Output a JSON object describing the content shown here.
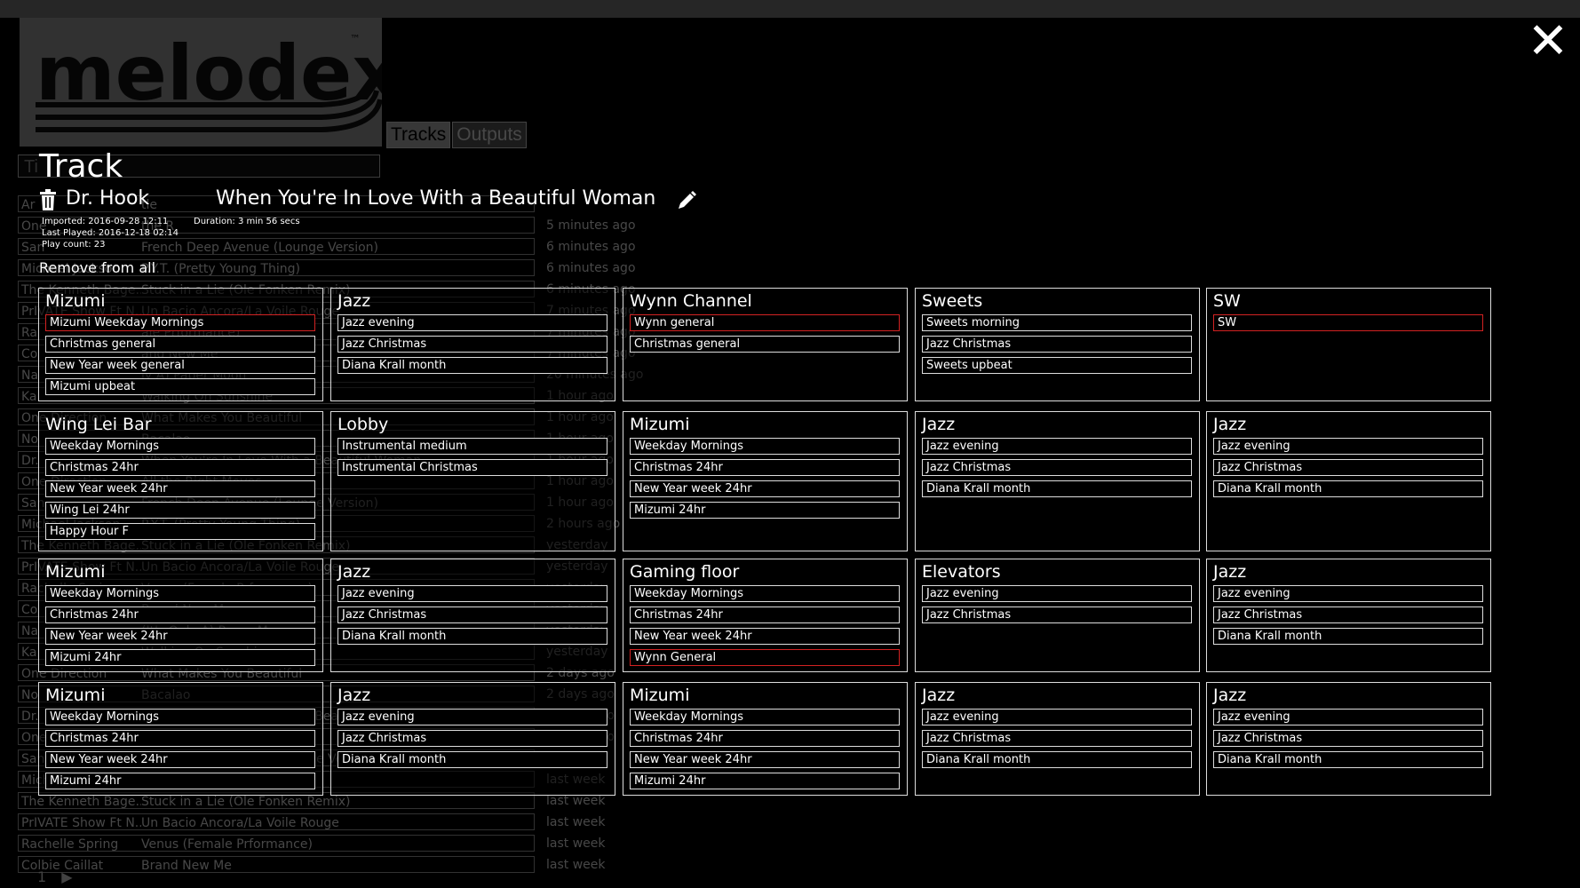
{
  "app": {
    "logo_text": "melodex",
    "trademark": "™"
  },
  "tabs": [
    "Tracks",
    "Outputs"
  ],
  "search": {
    "value": "Ti"
  },
  "close_label": "✕",
  "background_rows": [
    {
      "artist": "Ar",
      "title": "tle",
      "when": ""
    },
    {
      "artist": "One",
      "title": "the R",
      "when": "5 minutes ago"
    },
    {
      "artist": "San",
      "title": "French Deep Avenue (Lounge Version)",
      "when": "6 minutes ago"
    },
    {
      "artist": "Michael Jackson",
      "title": "P.Y.T. (Pretty Young Thing)",
      "when": "6 minutes ago"
    },
    {
      "artist": "The Kenneth Bage...",
      "title": "Stuck in a Lie (Ole Fonken Remix)",
      "when": "6 minutes ago"
    },
    {
      "artist": "PrIVATE Show Ft N...",
      "title": "Un Bacio Ancora/La Voile Rouge",
      "when": "7 minutes ago"
    },
    {
      "artist": "Ra",
      "title": "ale Prformance)",
      "when": "7 minutes ago"
    },
    {
      "artist": "Co",
      "title": "and New Me",
      "when": "7 minutes ago"
    },
    {
      "artist": "Na",
      "title": "ly A) Paper Moon",
      "when": "20 minutes ago"
    },
    {
      "artist": "Ka",
      "title": "Walking On Sunshine",
      "when": "1 hour ago"
    },
    {
      "artist": "One Direction",
      "title": "What Makes You Beautiful",
      "when": "1 hour ago"
    },
    {
      "artist": "No",
      "title": "Bacalao",
      "when": "1 hour ago"
    },
    {
      "artist": "Dr.",
      "title": "When You're In Love With a Beautiful Woman",
      "when": "1 hour ago"
    },
    {
      "artist": "One Direction",
      "title": "All the Right Moves",
      "when": "1 hour ago"
    },
    {
      "artist": "San",
      "title": "French Deep Avenue (Lounge Version)",
      "when": "1 hour ago"
    },
    {
      "artist": "Michael Jackson",
      "title": "P.Y.T. (Pretty Young Thing)",
      "when": "2 hours ago"
    },
    {
      "artist": "The Kenneth Bage...",
      "title": "Stuck in a Lie (Ole Fonken Remix)",
      "when": "yesterday"
    },
    {
      "artist": "PrIVATE Show Ft N...",
      "title": "Un Bacio Ancora/La Voile Rouge",
      "when": "yesterday"
    },
    {
      "artist": "Rachelle Spring",
      "title": "Venus (Female Prformance)",
      "when": "yesterday"
    },
    {
      "artist": "Co",
      "title": "Brand New Me",
      "when": "yesterday"
    },
    {
      "artist": "Na",
      "title": "(It's Only A) Paper Moon",
      "when": "yesterday"
    },
    {
      "artist": "Ka",
      "title": "Walking On Sunshine",
      "when": "yesterday"
    },
    {
      "artist": "One Direction",
      "title": "What Makes You Beautiful",
      "when": "2 days ago"
    },
    {
      "artist": "No",
      "title": "Bacalao",
      "when": "2 days ago"
    },
    {
      "artist": "Dr.",
      "title": "When You're In Love With a Beautiful Woman",
      "when": "2 days ago"
    },
    {
      "artist": "One Direction",
      "title": "All the Right Moves",
      "when": "2 days ago"
    },
    {
      "artist": "San",
      "title": "French Deep Avenue (Lounge Version)",
      "when": "last week"
    },
    {
      "artist": "Michael Jackson",
      "title": "P.Y.T. (Pretty Young Thing)",
      "when": "last week"
    },
    {
      "artist": "The Kenneth Bage...",
      "title": "Stuck in a Lie (Ole Fonken Remix)",
      "when": "last week"
    },
    {
      "artist": "PrIVATE Show Ft N...",
      "title": "Un Bacio Ancora/La Voile Rouge",
      "when": "last week"
    },
    {
      "artist": "Rachelle Spring",
      "title": "Venus (Female Prformance)",
      "when": "last week"
    },
    {
      "artist": "Colbie Caillat",
      "title": "Brand New Me",
      "when": "last week"
    }
  ],
  "pager": {
    "page": "1",
    "next": "▶"
  },
  "track": {
    "heading": "Track",
    "artist": "Dr. Hook",
    "title": "When You're In Love With a Beautiful Woman",
    "imported": "Imported: 2016-09-28 12:11",
    "duration": "Duration: 3 min 56 secs",
    "last_played": "Last Played: 2016-12-18 02:14",
    "play_count": "Play count: 23",
    "remove_all": "Remove from all"
  },
  "colors": {
    "selected_border": "#d32222",
    "card_border": "#dddddd"
  },
  "channels": [
    {
      "name": "Mizumi",
      "playlists": [
        {
          "label": "Mizumi Weekday Mornings",
          "selected": true
        },
        {
          "label": "Christmas general",
          "selected": false
        },
        {
          "label": "New Year week general",
          "selected": false
        },
        {
          "label": "Mizumi upbeat",
          "selected": false
        }
      ]
    },
    {
      "name": "Jazz",
      "playlists": [
        {
          "label": "Jazz evening",
          "selected": false
        },
        {
          "label": "Jazz Christmas",
          "selected": false
        },
        {
          "label": "Diana Krall month",
          "selected": false
        }
      ]
    },
    {
      "name": "Wynn Channel",
      "playlists": [
        {
          "label": "Wynn general",
          "selected": true
        },
        {
          "label": "Christmas general",
          "selected": false
        }
      ]
    },
    {
      "name": "Sweets",
      "playlists": [
        {
          "label": "Sweets morning",
          "selected": false
        },
        {
          "label": "Jazz Christmas",
          "selected": false
        },
        {
          "label": "Sweets upbeat",
          "selected": false
        }
      ]
    },
    {
      "name": "SW",
      "playlists": [
        {
          "label": "SW",
          "selected": true
        }
      ]
    },
    {
      "name": "Wing Lei Bar",
      "playlists": [
        {
          "label": "Weekday Mornings",
          "selected": false
        },
        {
          "label": "Christmas 24hr",
          "selected": false
        },
        {
          "label": "New Year week 24hr",
          "selected": false
        },
        {
          "label": "Wing Lei 24hr",
          "selected": false
        },
        {
          "label": "Happy Hour F",
          "selected": false
        }
      ]
    },
    {
      "name": "Lobby",
      "playlists": [
        {
          "label": "Instrumental medium",
          "selected": false
        },
        {
          "label": "Instrumental Christmas",
          "selected": false
        }
      ]
    },
    {
      "name": "Mizumi",
      "playlists": [
        {
          "label": "Weekday Mornings",
          "selected": false
        },
        {
          "label": "Christmas 24hr",
          "selected": false
        },
        {
          "label": "New Year week 24hr",
          "selected": false
        },
        {
          "label": "Mizumi 24hr",
          "selected": false
        }
      ]
    },
    {
      "name": "Jazz",
      "playlists": [
        {
          "label": "Jazz evening",
          "selected": false
        },
        {
          "label": "Jazz Christmas",
          "selected": false
        },
        {
          "label": "Diana Krall month",
          "selected": false
        }
      ]
    },
    {
      "name": "Jazz",
      "playlists": [
        {
          "label": "Jazz evening",
          "selected": false
        },
        {
          "label": "Jazz Christmas",
          "selected": false
        },
        {
          "label": "Diana Krall month",
          "selected": false
        }
      ]
    },
    {
      "name": "Mizumi",
      "playlists": [
        {
          "label": "Weekday Mornings",
          "selected": false
        },
        {
          "label": "Christmas 24hr",
          "selected": false
        },
        {
          "label": "New Year week 24hr",
          "selected": false
        },
        {
          "label": "Mizumi 24hr",
          "selected": false
        }
      ]
    },
    {
      "name": "Jazz",
      "playlists": [
        {
          "label": "Jazz evening",
          "selected": false
        },
        {
          "label": "Jazz Christmas",
          "selected": false
        },
        {
          "label": "Diana Krall month",
          "selected": false
        }
      ]
    },
    {
      "name": "Gaming floor",
      "playlists": [
        {
          "label": "Weekday Mornings",
          "selected": false
        },
        {
          "label": "Christmas 24hr",
          "selected": false
        },
        {
          "label": "New Year week 24hr",
          "selected": false
        },
        {
          "label": "Wynn General",
          "selected": true
        }
      ]
    },
    {
      "name": "Elevators",
      "playlists": [
        {
          "label": "Jazz evening",
          "selected": false
        },
        {
          "label": "Jazz Christmas",
          "selected": false
        }
      ]
    },
    {
      "name": "Jazz",
      "playlists": [
        {
          "label": "Jazz evening",
          "selected": false
        },
        {
          "label": "Jazz Christmas",
          "selected": false
        },
        {
          "label": "Diana Krall month",
          "selected": false
        }
      ]
    },
    {
      "name": "Mizumi",
      "playlists": [
        {
          "label": "Weekday Mornings",
          "selected": false
        },
        {
          "label": "Christmas 24hr",
          "selected": false
        },
        {
          "label": "New Year week 24hr",
          "selected": false
        },
        {
          "label": "Mizumi 24hr",
          "selected": false
        }
      ]
    },
    {
      "name": "Jazz",
      "playlists": [
        {
          "label": "Jazz evening",
          "selected": false
        },
        {
          "label": "Jazz Christmas",
          "selected": false
        },
        {
          "label": "Diana Krall month",
          "selected": false
        }
      ]
    },
    {
      "name": "Mizumi",
      "playlists": [
        {
          "label": "Weekday Mornings",
          "selected": false
        },
        {
          "label": "Christmas 24hr",
          "selected": false
        },
        {
          "label": "New Year week 24hr",
          "selected": false
        },
        {
          "label": "Mizumi 24hr",
          "selected": false
        }
      ]
    },
    {
      "name": "Jazz",
      "playlists": [
        {
          "label": "Jazz evening",
          "selected": false
        },
        {
          "label": "Jazz Christmas",
          "selected": false
        },
        {
          "label": "Diana Krall month",
          "selected": false
        }
      ]
    },
    {
      "name": "Jazz",
      "playlists": [
        {
          "label": "Jazz evening",
          "selected": false
        },
        {
          "label": "Jazz Christmas",
          "selected": false
        },
        {
          "label": "Diana Krall month",
          "selected": false
        }
      ]
    }
  ]
}
